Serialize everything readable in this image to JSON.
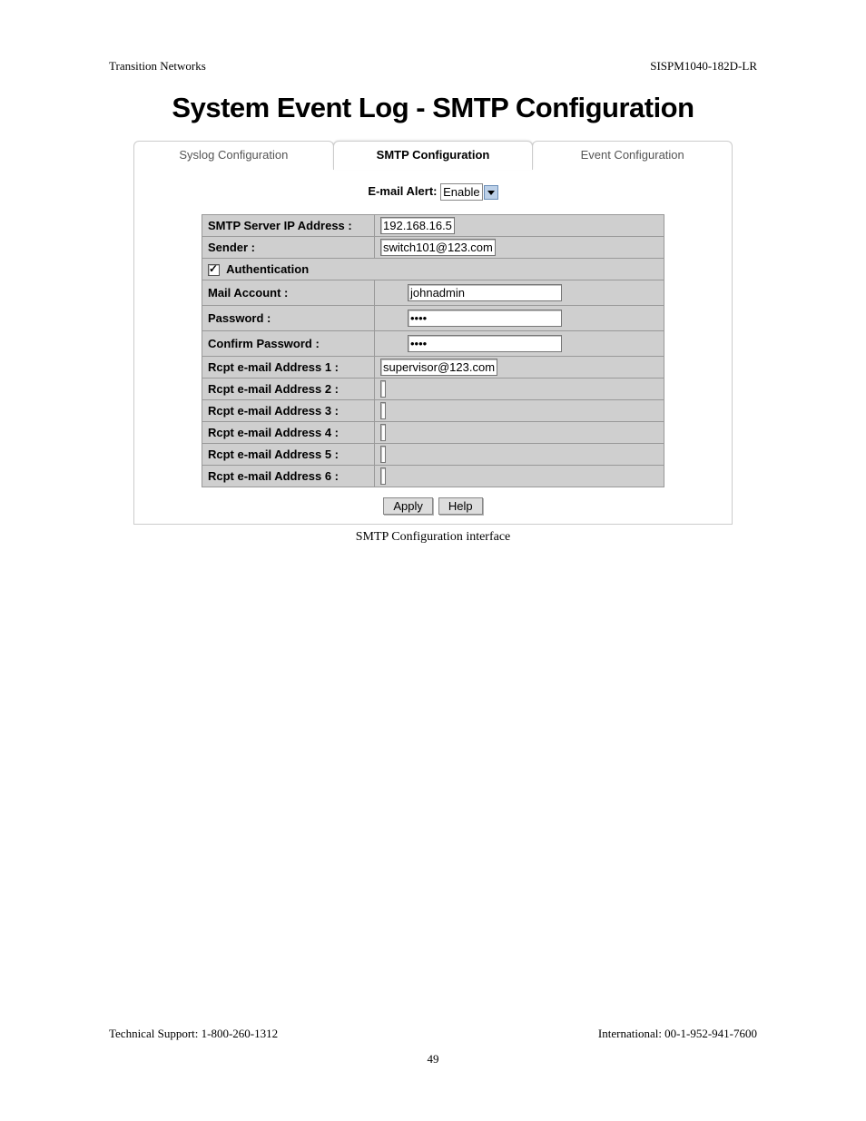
{
  "header": {
    "left": "Transition Networks",
    "right": "SISPM1040-182D-LR"
  },
  "title": "System Event Log - SMTP Configuration",
  "tabs": {
    "syslog": "Syslog Configuration",
    "smtp": "SMTP Configuration",
    "event": "Event Configuration"
  },
  "form": {
    "email_alert_label": "E-mail Alert:",
    "email_alert_value": "Enable",
    "smtp_server_label": "SMTP Server IP Address :",
    "smtp_server_value": "192.168.16.5",
    "sender_label": "Sender :",
    "sender_value": "switch101@123.com",
    "auth_label": "Authentication",
    "auth_checked": true,
    "mail_account_label": "Mail Account :",
    "mail_account_value": "johnadmin",
    "password_label": "Password :",
    "password_value": "••••",
    "confirm_password_label": "Confirm Password :",
    "confirm_password_value": "••••",
    "rcpt1_label": "Rcpt e-mail Address 1 :",
    "rcpt1_value": "supervisor@123.com",
    "rcpt2_label": "Rcpt e-mail Address 2 :",
    "rcpt2_value": "",
    "rcpt3_label": "Rcpt e-mail Address 3 :",
    "rcpt3_value": "",
    "rcpt4_label": "Rcpt e-mail Address 4 :",
    "rcpt4_value": "",
    "rcpt5_label": "Rcpt e-mail Address 5 :",
    "rcpt5_value": "",
    "rcpt6_label": "Rcpt e-mail Address 6 :",
    "rcpt6_value": ""
  },
  "buttons": {
    "apply": "Apply",
    "help": "Help"
  },
  "caption": "SMTP Configuration interface",
  "footer": {
    "left": "Technical Support: 1-800-260-1312",
    "right": "International: 00-1-952-941-7600",
    "page": "49"
  }
}
